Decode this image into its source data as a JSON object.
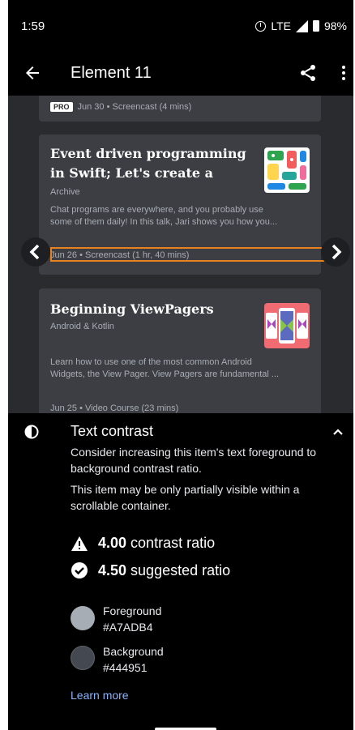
{
  "status_bar": {
    "time": "1:59",
    "network": "LTE",
    "battery": "98%"
  },
  "toolbar": {
    "title": "Element 11"
  },
  "cards": [
    {
      "meta": "Jun 30 • Screencast (4 mins)",
      "badge": "PRO"
    },
    {
      "title_line1": "Event driven programming",
      "title_line2": "in Swift; Let's create a",
      "category": "Archive",
      "desc_line1": "Chat programs are everywhere, and you probably use",
      "desc_line2": "some of them daily! In this talk, Jari shows you how you...",
      "meta": "Jun 26 • Screencast (1 hr, 40 mins)"
    },
    {
      "title_line1": "Beginning ViewPagers",
      "category": "Android & Kotlin",
      "desc_line1": "Learn how to use one of the most common Android",
      "desc_line2": "Widgets, the View Pager. View Pagers are fundamental ...",
      "meta": "Jun 25 • Video Course (23 mins)"
    }
  ],
  "panel": {
    "title": "Text contrast",
    "desc1": "Consider increasing this item's text foreground to background contrast ratio.",
    "desc2": "This item may be only partially visible within a scrollable container.",
    "current_ratio": "4.00",
    "current_label": "contrast ratio",
    "suggested_ratio": "4.50",
    "suggested_label": "suggested ratio",
    "foreground_label": "Foreground",
    "foreground_hex": "#A7ADB4",
    "background_label": "Background",
    "background_hex": "#444951",
    "learn_more": "Learn more"
  },
  "colors": {
    "foreground": "#A7ADB4",
    "background": "#444951",
    "highlight": "#e8821e",
    "link": "#8ab4f8"
  }
}
